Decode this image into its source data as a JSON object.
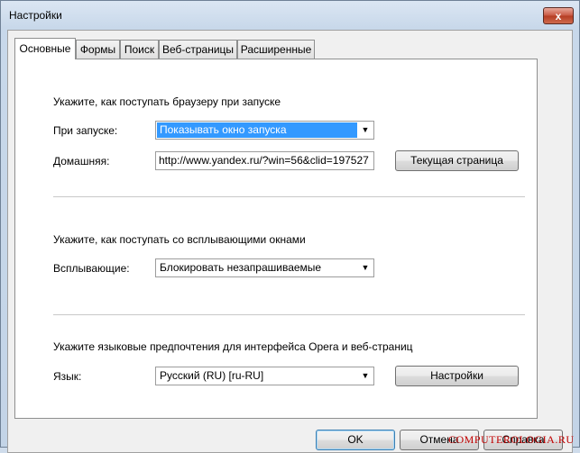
{
  "window": {
    "title": "Настройки",
    "close_label": "x"
  },
  "tabs": [
    {
      "label": "Основные",
      "active": true
    },
    {
      "label": "Формы"
    },
    {
      "label": "Поиск"
    },
    {
      "label": "Веб-страницы"
    },
    {
      "label": "Расширенные"
    }
  ],
  "startup": {
    "heading": "Укажите, как поступать браузеру при запуске",
    "on_start_label": "При запуске:",
    "on_start_value": "Показывать окно запуска",
    "home_label": "Домашняя:",
    "home_value": "http://www.yandex.ru/?win=56&clid=197527",
    "current_page_button": "Текущая страница"
  },
  "popups": {
    "heading": "Укажите, как поступать со всплывающими окнами",
    "label": "Всплывающие:",
    "value": "Блокировать незапрашиваемые"
  },
  "language": {
    "heading": "Укажите языковые предпочтения для интерфейса Opera и веб-страниц",
    "label": "Язык:",
    "value": "Русский (RU) [ru-RU]",
    "settings_button": "Настройки"
  },
  "footer": {
    "ok_button": "OK",
    "cancel_button": "Отмена",
    "help_button": "Справка"
  },
  "watermark": "COMPUTEROLOGIA.RU",
  "colors": {
    "selection": "#3399ff",
    "close_button": "#c7553f",
    "watermark": "#c00000"
  }
}
